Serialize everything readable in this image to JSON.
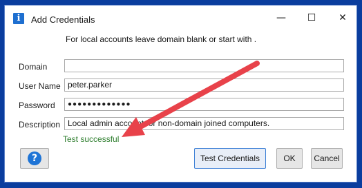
{
  "window": {
    "title": "Add Credentials",
    "app_icon_glyph": "i",
    "controls": {
      "minimize": "—",
      "maximize": "☐",
      "close": "✕"
    }
  },
  "hint": "For local accounts leave domain blank or start with .",
  "form": {
    "domain": {
      "label": "Domain",
      "value": ""
    },
    "username": {
      "label": "User Name",
      "value": "peter.parker"
    },
    "password": {
      "label": "Password",
      "value": "●●●●●●●●●●●●●"
    },
    "description": {
      "label": "Description",
      "value": "Local admin account for non-domain joined computers."
    }
  },
  "status": {
    "text": "Test successful",
    "color": "#2d7d2d"
  },
  "buttons": {
    "help_glyph": "?",
    "test": "Test Credentials",
    "ok": "OK",
    "cancel": "Cancel"
  },
  "annotation": {
    "arrow_color": "#e8424a"
  }
}
